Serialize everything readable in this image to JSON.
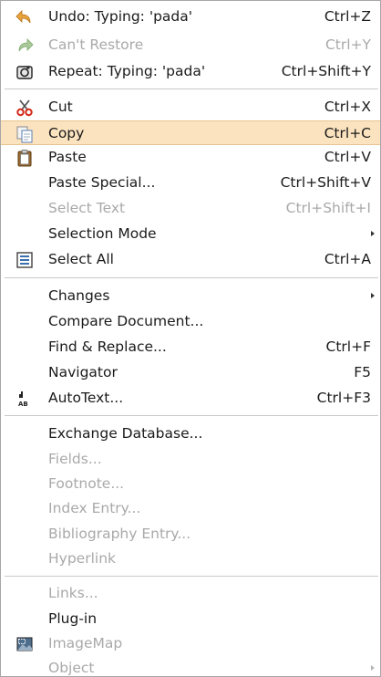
{
  "menu": {
    "items": [
      {
        "id": "undo",
        "label": "Undo: Typing: 'pada'",
        "shortcut": "Ctrl+Z",
        "icon": "undo-arrow-icon",
        "enabled": true
      },
      {
        "id": "cant-restore",
        "label": "Can't Restore",
        "shortcut": "Ctrl+Y",
        "icon": "redo-arrow-icon",
        "enabled": false
      },
      {
        "id": "repeat",
        "label": "Repeat: Typing: 'pada'",
        "shortcut": "Ctrl+Shift+Y",
        "icon": "repeat-icon",
        "enabled": true
      },
      {
        "id": "cut",
        "label": "Cut",
        "shortcut": "Ctrl+X",
        "icon": "scissors-icon",
        "enabled": true
      },
      {
        "id": "copy",
        "label": "Copy",
        "shortcut": "Ctrl+C",
        "icon": "copy-icon",
        "enabled": true,
        "highlighted": true
      },
      {
        "id": "paste",
        "label": "Paste",
        "shortcut": "Ctrl+V",
        "icon": "clipboard-icon",
        "enabled": true
      },
      {
        "id": "paste-special",
        "label": "Paste Special...",
        "shortcut": "Ctrl+Shift+V",
        "enabled": true
      },
      {
        "id": "select-text",
        "label": "Select Text",
        "shortcut": "Ctrl+Shift+I",
        "enabled": false
      },
      {
        "id": "selection-mode",
        "label": "Selection Mode",
        "shortcut": "",
        "enabled": true,
        "submenu": true
      },
      {
        "id": "select-all",
        "label": "Select All",
        "shortcut": "Ctrl+A",
        "icon": "select-all-icon",
        "enabled": true
      },
      {
        "id": "changes",
        "label": "Changes",
        "shortcut": "",
        "enabled": true,
        "submenu": true
      },
      {
        "id": "compare-document",
        "label": "Compare Document...",
        "shortcut": "",
        "enabled": true
      },
      {
        "id": "find-replace",
        "label": "Find & Replace...",
        "shortcut": "Ctrl+F",
        "enabled": true
      },
      {
        "id": "navigator",
        "label": "Navigator",
        "shortcut": "F5",
        "enabled": true
      },
      {
        "id": "autotext",
        "label": "AutoText...",
        "shortcut": "Ctrl+F3",
        "icon": "autotext-icon",
        "enabled": true
      },
      {
        "id": "exchange-database",
        "label": "Exchange Database...",
        "shortcut": "",
        "enabled": true
      },
      {
        "id": "fields",
        "label": "Fields...",
        "shortcut": "",
        "enabled": false
      },
      {
        "id": "footnote",
        "label": "Footnote...",
        "shortcut": "",
        "enabled": false
      },
      {
        "id": "index-entry",
        "label": "Index Entry...",
        "shortcut": "",
        "enabled": false
      },
      {
        "id": "bibliography-entry",
        "label": "Bibliography Entry...",
        "shortcut": "",
        "enabled": false
      },
      {
        "id": "hyperlink",
        "label": "Hyperlink",
        "shortcut": "",
        "enabled": false
      },
      {
        "id": "links",
        "label": "Links...",
        "shortcut": "",
        "enabled": false
      },
      {
        "id": "plug-in",
        "label": "Plug-in",
        "shortcut": "",
        "enabled": true
      },
      {
        "id": "imagemap",
        "label": "ImageMap",
        "shortcut": "",
        "icon": "imagemap-icon",
        "enabled": false
      },
      {
        "id": "object",
        "label": "Object",
        "shortcut": "",
        "enabled": false,
        "submenu": true
      }
    ]
  },
  "colors": {
    "highlight_background": "#fbe3bf",
    "highlight_border": "#e7c590",
    "enabled_text": "#1a1a1a",
    "disabled_text": "#a9a9a9",
    "separator": "#c9c9c9"
  }
}
